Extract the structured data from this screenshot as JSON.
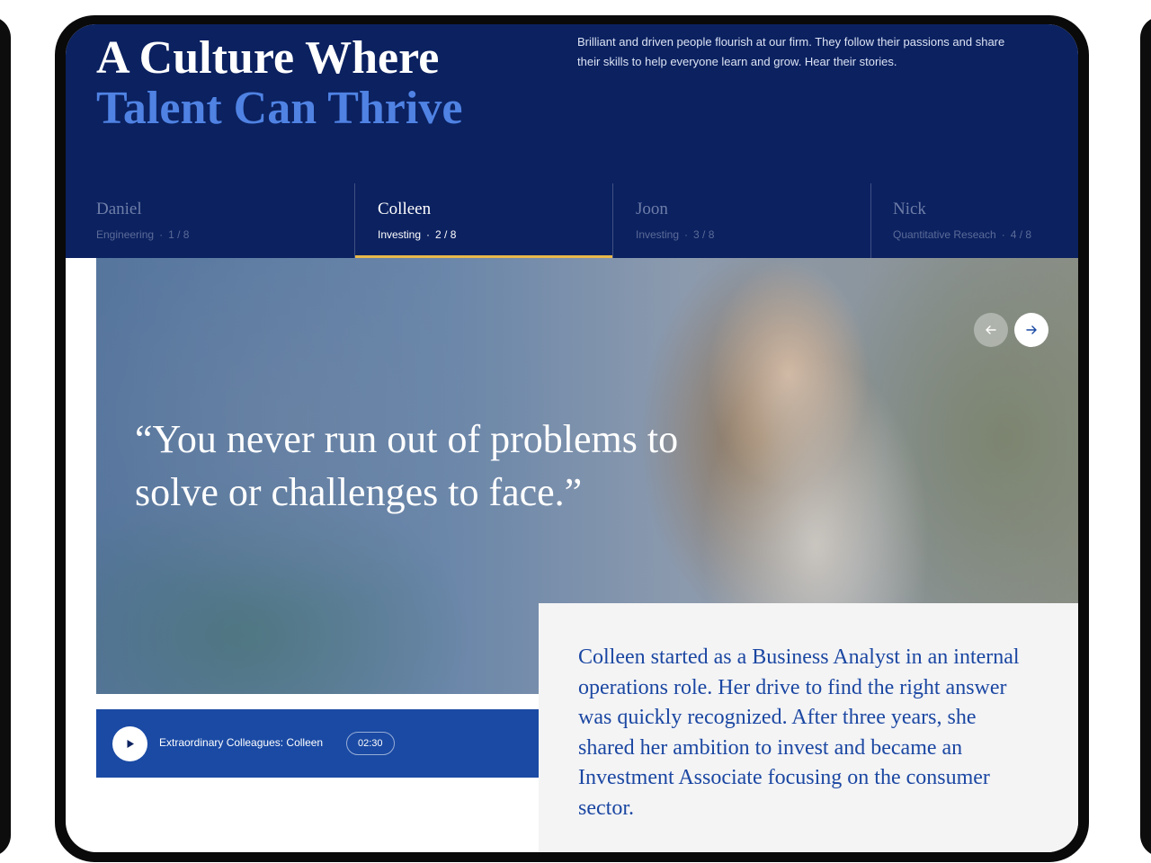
{
  "header": {
    "title_line1": "A Culture Where",
    "title_line2": "Talent Can Thrive",
    "intro": "Brilliant and driven people flourish at our firm. They follow their passions and share their skills to help everyone learn and grow. Hear their stories."
  },
  "tabs": [
    {
      "name": "Daniel",
      "team": "Engineering",
      "position": "1 / 8",
      "active": false
    },
    {
      "name": "Colleen",
      "team": "Investing",
      "position": "2 / 8",
      "active": true
    },
    {
      "name": "Joon",
      "team": "Investing",
      "position": "3 / 8",
      "active": false
    },
    {
      "name": "Nick",
      "team": "Quantitative Reseach",
      "position": "4 / 8",
      "active": false
    }
  ],
  "tab_separator": "·",
  "quote": "“You never run out of problems to solve or challenges to face.”",
  "carousel": {
    "prev_icon": "arrow-left-icon",
    "next_icon": "arrow-right-icon"
  },
  "video": {
    "play_icon": "play-icon",
    "title": "Extraordinary Colleagues: Colleen",
    "duration": "02:30"
  },
  "story": "Colleen started as a Business Analyst in an internal operations role. Her drive to find the right answer was quickly recognized. After three years, she shared her ambition to invest and became an Investment Associate focusing on the consumer sector.",
  "colors": {
    "navy": "#0b2160",
    "accent_blue": "#4f82e3",
    "video_bar": "#1a4aa4",
    "tab_underline": "#e8b84a",
    "story_text": "#1b47a2"
  }
}
